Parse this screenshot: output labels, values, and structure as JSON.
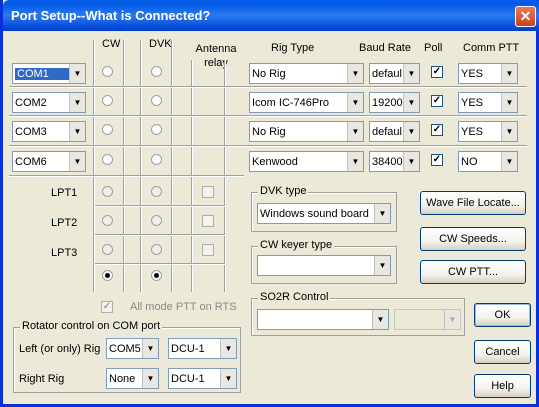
{
  "window": {
    "title": "Port Setup--What is Connected?",
    "close": "✕"
  },
  "headers": {
    "cw": "CW",
    "dvk": "DVK",
    "antenna_relay": "Antenna relay",
    "rig_type": "Rig Type",
    "baud_rate": "Baud Rate",
    "poll": "Poll",
    "comm_ptt": "Comm PTT"
  },
  "com_rows": [
    {
      "port": "COM1",
      "port_selected": true,
      "rig": "No Rig",
      "baud": "defaul",
      "poll": true,
      "ptt": "YES"
    },
    {
      "port": "COM2",
      "port_selected": false,
      "rig": "Icom IC-746Pro",
      "baud": "19200",
      "poll": true,
      "ptt": "YES"
    },
    {
      "port": "COM3",
      "port_selected": false,
      "rig": "No Rig",
      "baud": "defaul",
      "poll": true,
      "ptt": "YES"
    },
    {
      "port": "COM6",
      "port_selected": false,
      "rig": "Kenwood",
      "baud": "38400",
      "poll": true,
      "ptt": "NO"
    }
  ],
  "lpt_rows": [
    {
      "label": "LPT1"
    },
    {
      "label": "LPT2"
    },
    {
      "label": "LPT3"
    }
  ],
  "bottom_radios": {
    "cw_checked": true,
    "dvk_checked": true
  },
  "all_mode_ptt": {
    "label": "All mode PTT on  RTS",
    "checked": true
  },
  "dvk_type": {
    "title": "DVK type",
    "value": "Windows sound board"
  },
  "cw_keyer_type": {
    "title": "CW keyer type",
    "value": ""
  },
  "so2r": {
    "title": "SO2R Control",
    "value": "",
    "value2": ""
  },
  "rotator": {
    "title": "Rotator control on COM port",
    "left_label": "Left (or only) Rig",
    "left_port": "COM5",
    "left_type": "DCU-1",
    "right_label": "Right Rig",
    "right_port": "None",
    "right_type": "DCU-1"
  },
  "buttons": {
    "wave_file": "Wave File Locate...",
    "cw_speeds": "CW Speeds...",
    "cw_ptt": "CW PTT...",
    "ok": "OK",
    "cancel": "Cancel",
    "help": "Help"
  },
  "glyphs": {
    "dropdown": "▼",
    "check": "✓"
  },
  "colors": {
    "title_bar": "#0058e6",
    "dialog_bg": "#ece9d8",
    "selection": "#316ac5"
  }
}
